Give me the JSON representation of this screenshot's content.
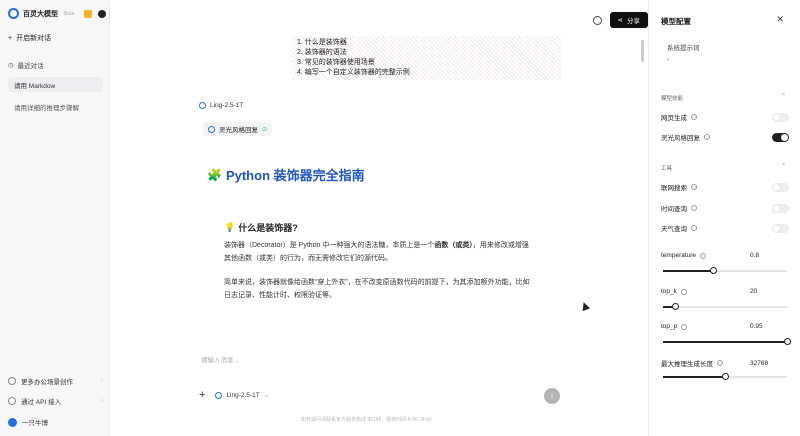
{
  "sidebar": {
    "app_title": "百灵大模型",
    "beta": "Beta",
    "new_chat": "开启新对话",
    "recent_label": "最近对话",
    "conversations": [
      "请用 Markdow",
      "请用详细的推理步骤解"
    ],
    "bottom": [
      {
        "label": "更多办公场景创作"
      },
      {
        "label": "通过 API 接入"
      },
      {
        "label": "一只牛博"
      }
    ]
  },
  "header": {
    "share_label": "分享"
  },
  "toc": [
    "1. 什么是装饰器",
    "2. 装饰器的语法",
    "3. 常见的装饰器使用场景",
    "4. 编写一个自定义装饰器的完整示例"
  ],
  "answer": {
    "model_name": "Ling-2.5-1T",
    "style_tag": "灵光风格回复",
    "title_emoji": "🧩",
    "title": "Python 装饰器完全指南",
    "section_emoji": "💡",
    "section_title": "什么是装饰器?",
    "p1_a": "装饰器（Decorator）是 Python 中一种强大的语法糖，本质上是一个",
    "p1_b": "函数（或类）",
    "p1_c": "，用来修改或增强其他函数（或类）的行为，而无需修改它们的源代码。",
    "p2": "简单来说，装饰器就像给函数“穿上外衣”，在不改变原函数代码的前提下，为其添加额外功能，比如日志记录、性能计时、权限验证等。"
  },
  "composer": {
    "placeholder": "请输入消息...",
    "model": "Ling-2.5-1T",
    "footer": "如有疑问请联系官方服务热线 95188，服务时间 8:00-24:00"
  },
  "panel": {
    "title": "模型配置",
    "system_prompt_label": "系统提示词",
    "system_prompt_value": "-",
    "model_skills_label": "模型技能",
    "skills": [
      {
        "label": "网页生成",
        "on": false
      },
      {
        "label": "灵光风格回复",
        "on": true
      }
    ],
    "tools_label": "工具",
    "tools": [
      {
        "label": "联网搜索",
        "on": false
      },
      {
        "label": "时间查询",
        "on": false
      },
      {
        "label": "天气查询",
        "on": false
      }
    ],
    "params": [
      {
        "label": "temperature",
        "value": "0.8",
        "fraction": 0.4
      },
      {
        "label": "top_k",
        "value": "20",
        "fraction": 0.1
      },
      {
        "label": "top_p",
        "value": "0.95",
        "fraction": 1.0
      },
      {
        "label": "最大推理生成长度",
        "value": "32768",
        "fraction": 0.5
      }
    ]
  },
  "colors": {
    "accent": "#2a6fe0",
    "title_blue": "#1f55c4"
  }
}
